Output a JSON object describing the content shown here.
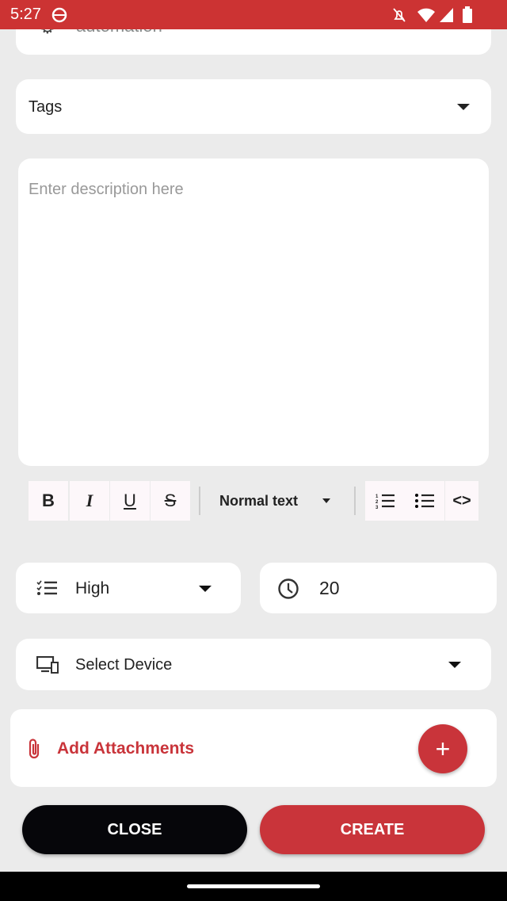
{
  "status_bar": {
    "time": "5:27",
    "icons": [
      "android-debug-icon",
      "notifications-off-icon",
      "wifi-icon",
      "signal-icon",
      "battery-icon"
    ]
  },
  "category_field": {
    "value": "automation",
    "icon": "gear-icon"
  },
  "tags_field": {
    "label": "Tags"
  },
  "description": {
    "placeholder": "Enter description here"
  },
  "toolbar": {
    "bold": "B",
    "italic": "I",
    "underline": "U",
    "strike": "S",
    "text_style": "Normal text",
    "ordered_list": "ordered-list-icon",
    "bullet_list": "bullet-list-icon",
    "code": "<>"
  },
  "priority_field": {
    "value": "High",
    "icon": "checklist-icon"
  },
  "time_field": {
    "value": "20",
    "icon": "clock-icon"
  },
  "device_field": {
    "value": "Select Device",
    "icon": "devices-icon"
  },
  "attachments": {
    "label": "Add Attachments",
    "add": "+"
  },
  "actions": {
    "close": "CLOSE",
    "create": "CREATE"
  },
  "colors": {
    "accent": "#c9343a",
    "status_bar": "#cc3333",
    "close_button": "#06060a"
  }
}
